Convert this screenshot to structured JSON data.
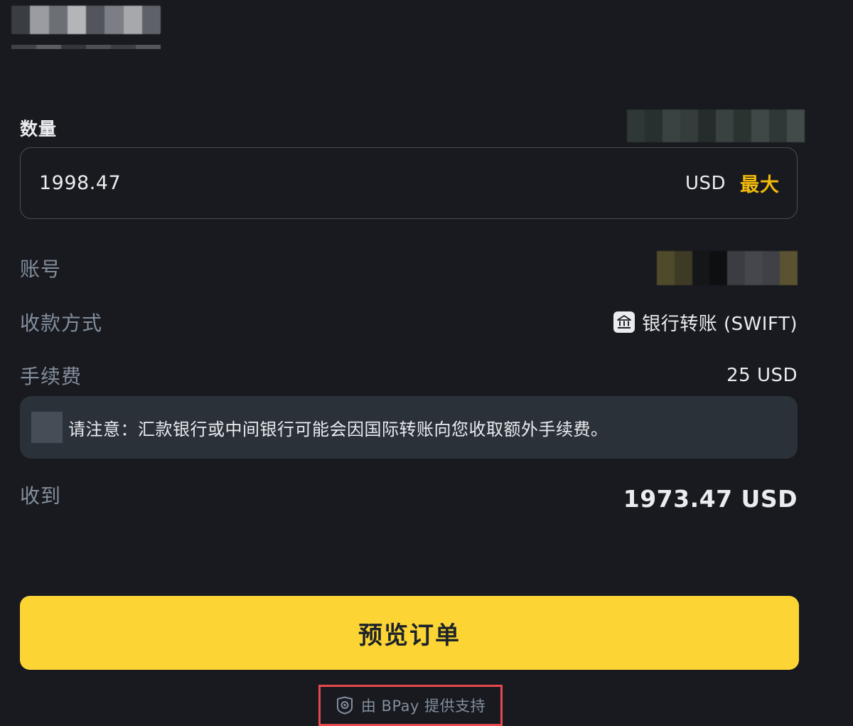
{
  "form": {
    "amount_label": "数量",
    "amount_value": "1998.47",
    "currency": "USD",
    "max_label": "最大"
  },
  "details": {
    "account_label": "账号",
    "method_label": "收款方式",
    "method_value": "银行转账 (SWIFT)",
    "fee_label": "手续费",
    "fee_value": "25 USD",
    "notice_text": "请注意：汇款银行或中间银行可能会因国际转账向您收取额外手续费。",
    "receive_label": "收到",
    "receive_value": "1973.47 USD"
  },
  "actions": {
    "preview_label": "预览订单"
  },
  "footer": {
    "powered_by": "由 BPay 提供支持"
  },
  "colors": {
    "background": "#181a20",
    "accent_yellow": "#fcd535",
    "max_text": "#f0b90b",
    "highlight_box": "#e5484d"
  },
  "icons": {
    "method": "bank-icon",
    "footer": "shield-icon",
    "notice": "info-icon"
  }
}
